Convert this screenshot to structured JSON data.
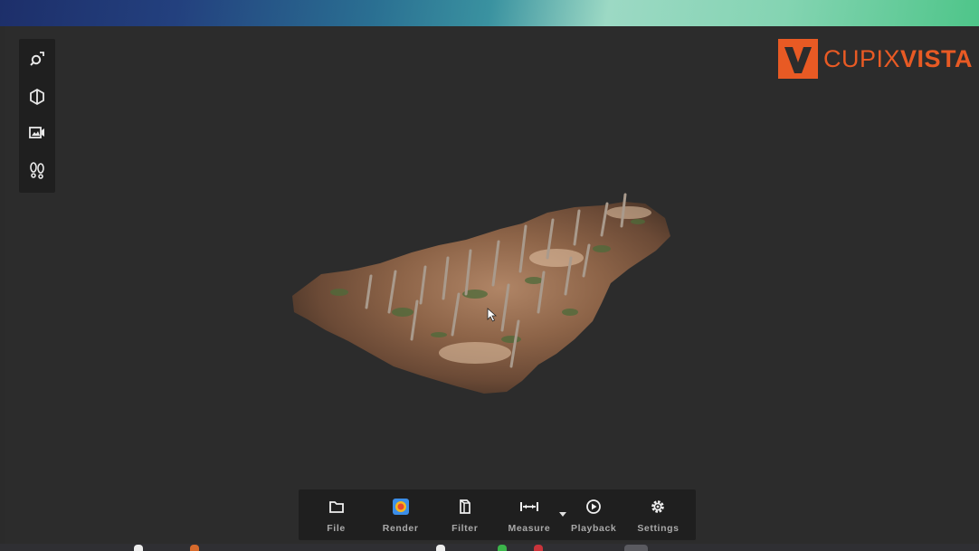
{
  "brand": {
    "name_light": "CUPIX",
    "name_bold": "VISTA",
    "accent_color": "#e85a24"
  },
  "left_tools": [
    {
      "name": "zoom-extent-icon"
    },
    {
      "name": "section-box-icon"
    },
    {
      "name": "camera-capture-icon"
    },
    {
      "name": "footprints-icon"
    }
  ],
  "bottom_toolbar": {
    "file": "File",
    "render": "Render",
    "filter": "Filter",
    "measure": "Measure",
    "playback": "Playback",
    "settings": "Settings"
  },
  "colors": {
    "background": "#2c2c2c",
    "panel": "#1f1f1f",
    "label": "#a9a9a9"
  }
}
